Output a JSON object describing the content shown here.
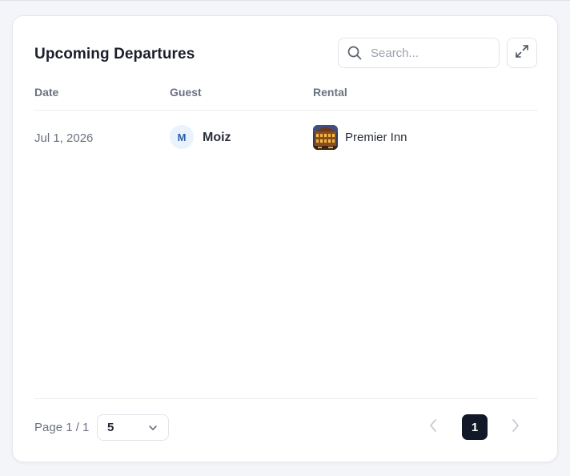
{
  "widget": {
    "title": "Upcoming Departures",
    "search_placeholder": "Search...",
    "expand_icon": "expand-icon"
  },
  "table": {
    "columns": [
      "Date",
      "Guest",
      "Rental"
    ],
    "rows": [
      {
        "date": "Jul 1, 2026",
        "guest_initial": "M",
        "guest_name": "Moiz",
        "rental_name": "Premier Inn",
        "rental_thumbnail": "hotel-thumbnail"
      }
    ]
  },
  "footer": {
    "page_label": "Page 1 / 1",
    "page_size": "5",
    "current_page": "1"
  },
  "colors": {
    "accent_dark": "#111827",
    "avatar_bg": "#eaf2fd",
    "avatar_text": "#2a5ea8",
    "muted_text": "#6b7280"
  }
}
